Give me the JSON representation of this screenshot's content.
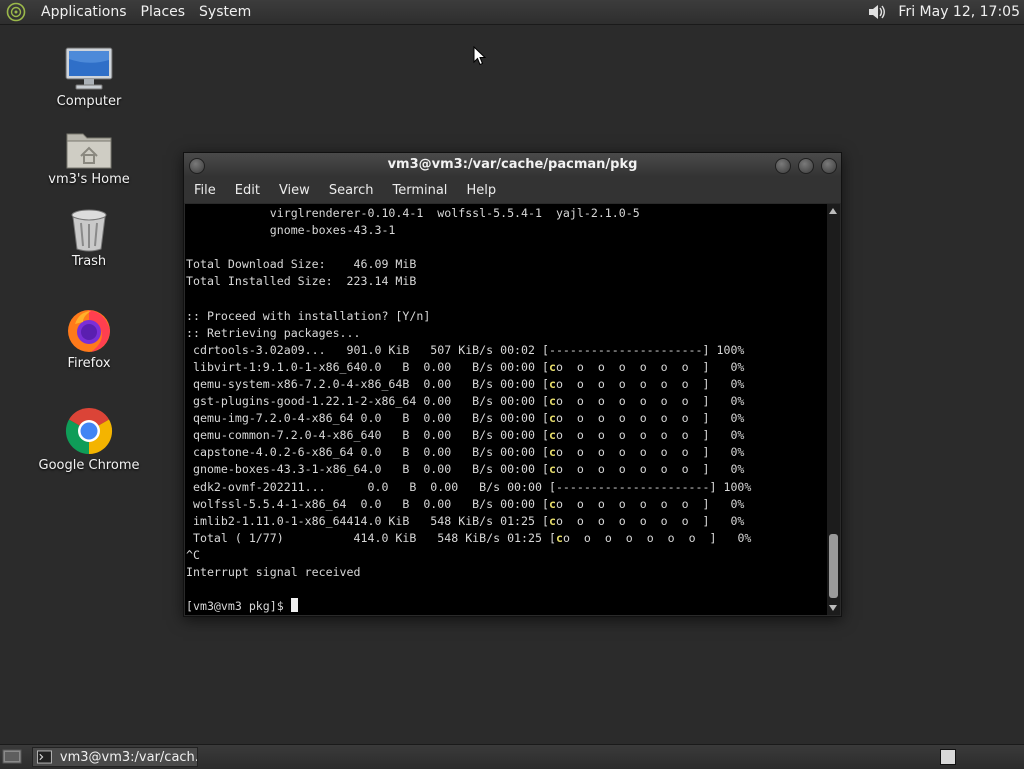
{
  "top_panel": {
    "menus": [
      "Applications",
      "Places",
      "System"
    ],
    "clock": "Fri May 12, 17:05"
  },
  "desktop_icons": [
    {
      "label": "Computer",
      "icon": "computer-icon"
    },
    {
      "label": "vm3's Home",
      "icon": "home-folder-icon"
    },
    {
      "label": "Trash",
      "icon": "trash-icon"
    },
    {
      "label": "Firefox",
      "icon": "firefox-icon"
    },
    {
      "label": "Google Chrome",
      "icon": "chrome-icon"
    }
  ],
  "window": {
    "title": "vm3@vm3:/var/cache/pacman/pkg",
    "menus": [
      "File",
      "Edit",
      "View",
      "Search",
      "Terminal",
      "Help"
    ]
  },
  "terminal": {
    "lines": [
      "            virglrenderer-0.10.4-1  wolfssl-5.5.4-1  yajl-2.1.0-5",
      "            gnome-boxes-43.3-1",
      "",
      "Total Download Size:    46.09 MiB",
      "Total Installed Size:  223.14 MiB",
      "",
      ":: Proceed with installation? [Y/n]",
      ":: Retrieving packages...",
      " cdrtools-3.02a09...   901.0 KiB   507 KiB/s 00:02 [----------------------] 100%",
      " libvirt-1:9.1.0-1-x86_640.0   B  0.00   B/s 00:00 [co  o  o  o  o  o  o  ]   0%",
      " qemu-system-x86-7.2.0-4-x86_64B  0.00   B/s 00:00 [co  o  o  o  o  o  o  ]   0%",
      " gst-plugins-good-1.22.1-2-x86_64 0.00   B/s 00:00 [co  o  o  o  o  o  o  ]   0%",
      " qemu-img-7.2.0-4-x86_64 0.0   B  0.00   B/s 00:00 [co  o  o  o  o  o  o  ]   0%",
      " qemu-common-7.2.0-4-x86_640   B  0.00   B/s 00:00 [co  o  o  o  o  o  o  ]   0%",
      " capstone-4.0.2-6-x86_64 0.0   B  0.00   B/s 00:00 [co  o  o  o  o  o  o  ]   0%",
      " gnome-boxes-43.3-1-x86_64.0   B  0.00   B/s 00:00 [co  o  o  o  o  o  o  ]   0%",
      " edk2-ovmf-202211...      0.0   B  0.00   B/s 00:00 [----------------------] 100%",
      " wolfssl-5.5.4-1-x86_64  0.0   B  0.00   B/s 00:00 [co  o  o  o  o  o  o  ]   0%",
      " imlib2-1.11.0-1-x86_64414.0 KiB   548 KiB/s 01:25 [co  o  o  o  o  o  o  ]   0%",
      " Total ( 1/77)          414.0 KiB   548 KiB/s 01:25 [co  o  o  o  o  o  o  ]   0%",
      "^C",
      "Interrupt signal received",
      ""
    ],
    "prompt": "[vm3@vm3 pkg]$ "
  },
  "taskbar": {
    "window_button": "vm3@vm3:/var/cach..."
  },
  "colors": {
    "desktop_bg": "#2b2b2b",
    "terminal_bg": "#000000",
    "terminal_fg": "#d8d8d8",
    "pacman_yellow": "#e6dc6a"
  }
}
